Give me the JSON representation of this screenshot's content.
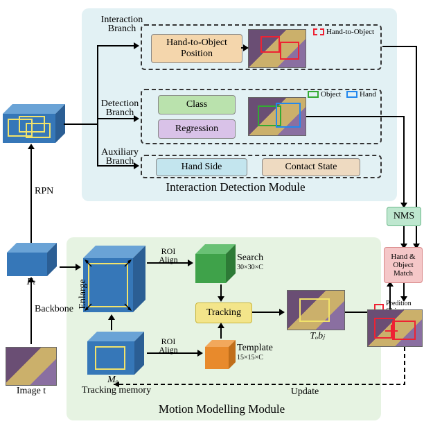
{
  "idm": {
    "title": "Interaction Detection Module",
    "interaction": {
      "branch": "Interaction Branch",
      "pill": "Hand-to-Object Position",
      "legend": "Hand-to-Object"
    },
    "detection": {
      "branch": "Detection Branch",
      "class": "Class",
      "regression": "Regression",
      "legendObj": "Object",
      "legendHand": "Hand"
    },
    "auxiliary": {
      "branch": "Auxiliary Branch",
      "handside": "Hand Side",
      "contact": "Contact State"
    }
  },
  "mmm": {
    "title": "Motion Modelling Module",
    "roi": "ROI Align",
    "search": "Search",
    "searchDim": "30×30×C",
    "template": "Template",
    "templateDim": "15×15×C",
    "tracking": "Tracking",
    "tobj": "Tₒbⱼ",
    "enlarge": "Enlarge",
    "mo": "Mₒ",
    "memory": "Tracking memory",
    "update": "Update"
  },
  "left": {
    "image": "Image t",
    "backbone": "Backbone",
    "ft": "Fₜ",
    "rpn": "RPN"
  },
  "right": {
    "nms": "NMS",
    "match": "Hand & Object Match",
    "pred": "Predition Object"
  }
}
